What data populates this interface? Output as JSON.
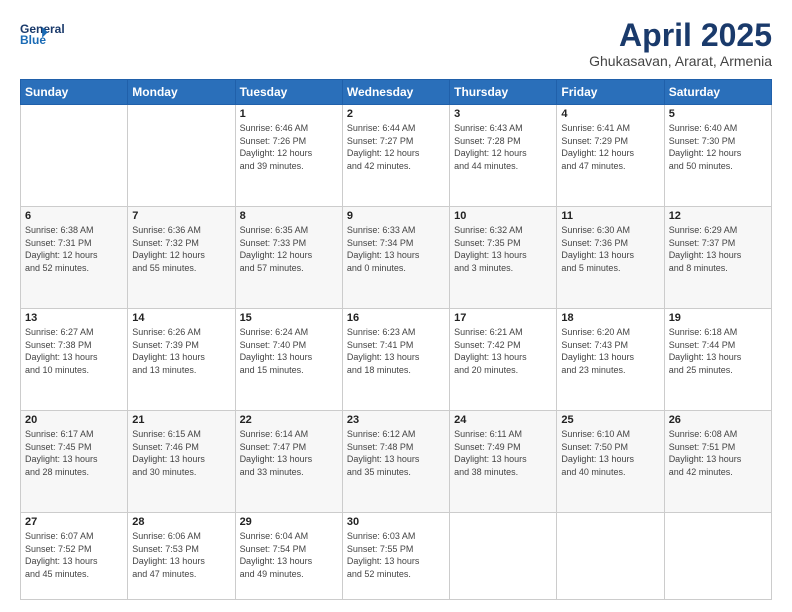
{
  "header": {
    "logo_line1": "General",
    "logo_line2": "Blue",
    "month": "April 2025",
    "location": "Ghukasavan, Ararat, Armenia"
  },
  "days_of_week": [
    "Sunday",
    "Monday",
    "Tuesday",
    "Wednesday",
    "Thursday",
    "Friday",
    "Saturday"
  ],
  "weeks": [
    [
      {
        "day": "",
        "info": ""
      },
      {
        "day": "",
        "info": ""
      },
      {
        "day": "1",
        "info": "Sunrise: 6:46 AM\nSunset: 7:26 PM\nDaylight: 12 hours\nand 39 minutes."
      },
      {
        "day": "2",
        "info": "Sunrise: 6:44 AM\nSunset: 7:27 PM\nDaylight: 12 hours\nand 42 minutes."
      },
      {
        "day": "3",
        "info": "Sunrise: 6:43 AM\nSunset: 7:28 PM\nDaylight: 12 hours\nand 44 minutes."
      },
      {
        "day": "4",
        "info": "Sunrise: 6:41 AM\nSunset: 7:29 PM\nDaylight: 12 hours\nand 47 minutes."
      },
      {
        "day": "5",
        "info": "Sunrise: 6:40 AM\nSunset: 7:30 PM\nDaylight: 12 hours\nand 50 minutes."
      }
    ],
    [
      {
        "day": "6",
        "info": "Sunrise: 6:38 AM\nSunset: 7:31 PM\nDaylight: 12 hours\nand 52 minutes."
      },
      {
        "day": "7",
        "info": "Sunrise: 6:36 AM\nSunset: 7:32 PM\nDaylight: 12 hours\nand 55 minutes."
      },
      {
        "day": "8",
        "info": "Sunrise: 6:35 AM\nSunset: 7:33 PM\nDaylight: 12 hours\nand 57 minutes."
      },
      {
        "day": "9",
        "info": "Sunrise: 6:33 AM\nSunset: 7:34 PM\nDaylight: 13 hours\nand 0 minutes."
      },
      {
        "day": "10",
        "info": "Sunrise: 6:32 AM\nSunset: 7:35 PM\nDaylight: 13 hours\nand 3 minutes."
      },
      {
        "day": "11",
        "info": "Sunrise: 6:30 AM\nSunset: 7:36 PM\nDaylight: 13 hours\nand 5 minutes."
      },
      {
        "day": "12",
        "info": "Sunrise: 6:29 AM\nSunset: 7:37 PM\nDaylight: 13 hours\nand 8 minutes."
      }
    ],
    [
      {
        "day": "13",
        "info": "Sunrise: 6:27 AM\nSunset: 7:38 PM\nDaylight: 13 hours\nand 10 minutes."
      },
      {
        "day": "14",
        "info": "Sunrise: 6:26 AM\nSunset: 7:39 PM\nDaylight: 13 hours\nand 13 minutes."
      },
      {
        "day": "15",
        "info": "Sunrise: 6:24 AM\nSunset: 7:40 PM\nDaylight: 13 hours\nand 15 minutes."
      },
      {
        "day": "16",
        "info": "Sunrise: 6:23 AM\nSunset: 7:41 PM\nDaylight: 13 hours\nand 18 minutes."
      },
      {
        "day": "17",
        "info": "Sunrise: 6:21 AM\nSunset: 7:42 PM\nDaylight: 13 hours\nand 20 minutes."
      },
      {
        "day": "18",
        "info": "Sunrise: 6:20 AM\nSunset: 7:43 PM\nDaylight: 13 hours\nand 23 minutes."
      },
      {
        "day": "19",
        "info": "Sunrise: 6:18 AM\nSunset: 7:44 PM\nDaylight: 13 hours\nand 25 minutes."
      }
    ],
    [
      {
        "day": "20",
        "info": "Sunrise: 6:17 AM\nSunset: 7:45 PM\nDaylight: 13 hours\nand 28 minutes."
      },
      {
        "day": "21",
        "info": "Sunrise: 6:15 AM\nSunset: 7:46 PM\nDaylight: 13 hours\nand 30 minutes."
      },
      {
        "day": "22",
        "info": "Sunrise: 6:14 AM\nSunset: 7:47 PM\nDaylight: 13 hours\nand 33 minutes."
      },
      {
        "day": "23",
        "info": "Sunrise: 6:12 AM\nSunset: 7:48 PM\nDaylight: 13 hours\nand 35 minutes."
      },
      {
        "day": "24",
        "info": "Sunrise: 6:11 AM\nSunset: 7:49 PM\nDaylight: 13 hours\nand 38 minutes."
      },
      {
        "day": "25",
        "info": "Sunrise: 6:10 AM\nSunset: 7:50 PM\nDaylight: 13 hours\nand 40 minutes."
      },
      {
        "day": "26",
        "info": "Sunrise: 6:08 AM\nSunset: 7:51 PM\nDaylight: 13 hours\nand 42 minutes."
      }
    ],
    [
      {
        "day": "27",
        "info": "Sunrise: 6:07 AM\nSunset: 7:52 PM\nDaylight: 13 hours\nand 45 minutes."
      },
      {
        "day": "28",
        "info": "Sunrise: 6:06 AM\nSunset: 7:53 PM\nDaylight: 13 hours\nand 47 minutes."
      },
      {
        "day": "29",
        "info": "Sunrise: 6:04 AM\nSunset: 7:54 PM\nDaylight: 13 hours\nand 49 minutes."
      },
      {
        "day": "30",
        "info": "Sunrise: 6:03 AM\nSunset: 7:55 PM\nDaylight: 13 hours\nand 52 minutes."
      },
      {
        "day": "",
        "info": ""
      },
      {
        "day": "",
        "info": ""
      },
      {
        "day": "",
        "info": ""
      }
    ]
  ]
}
